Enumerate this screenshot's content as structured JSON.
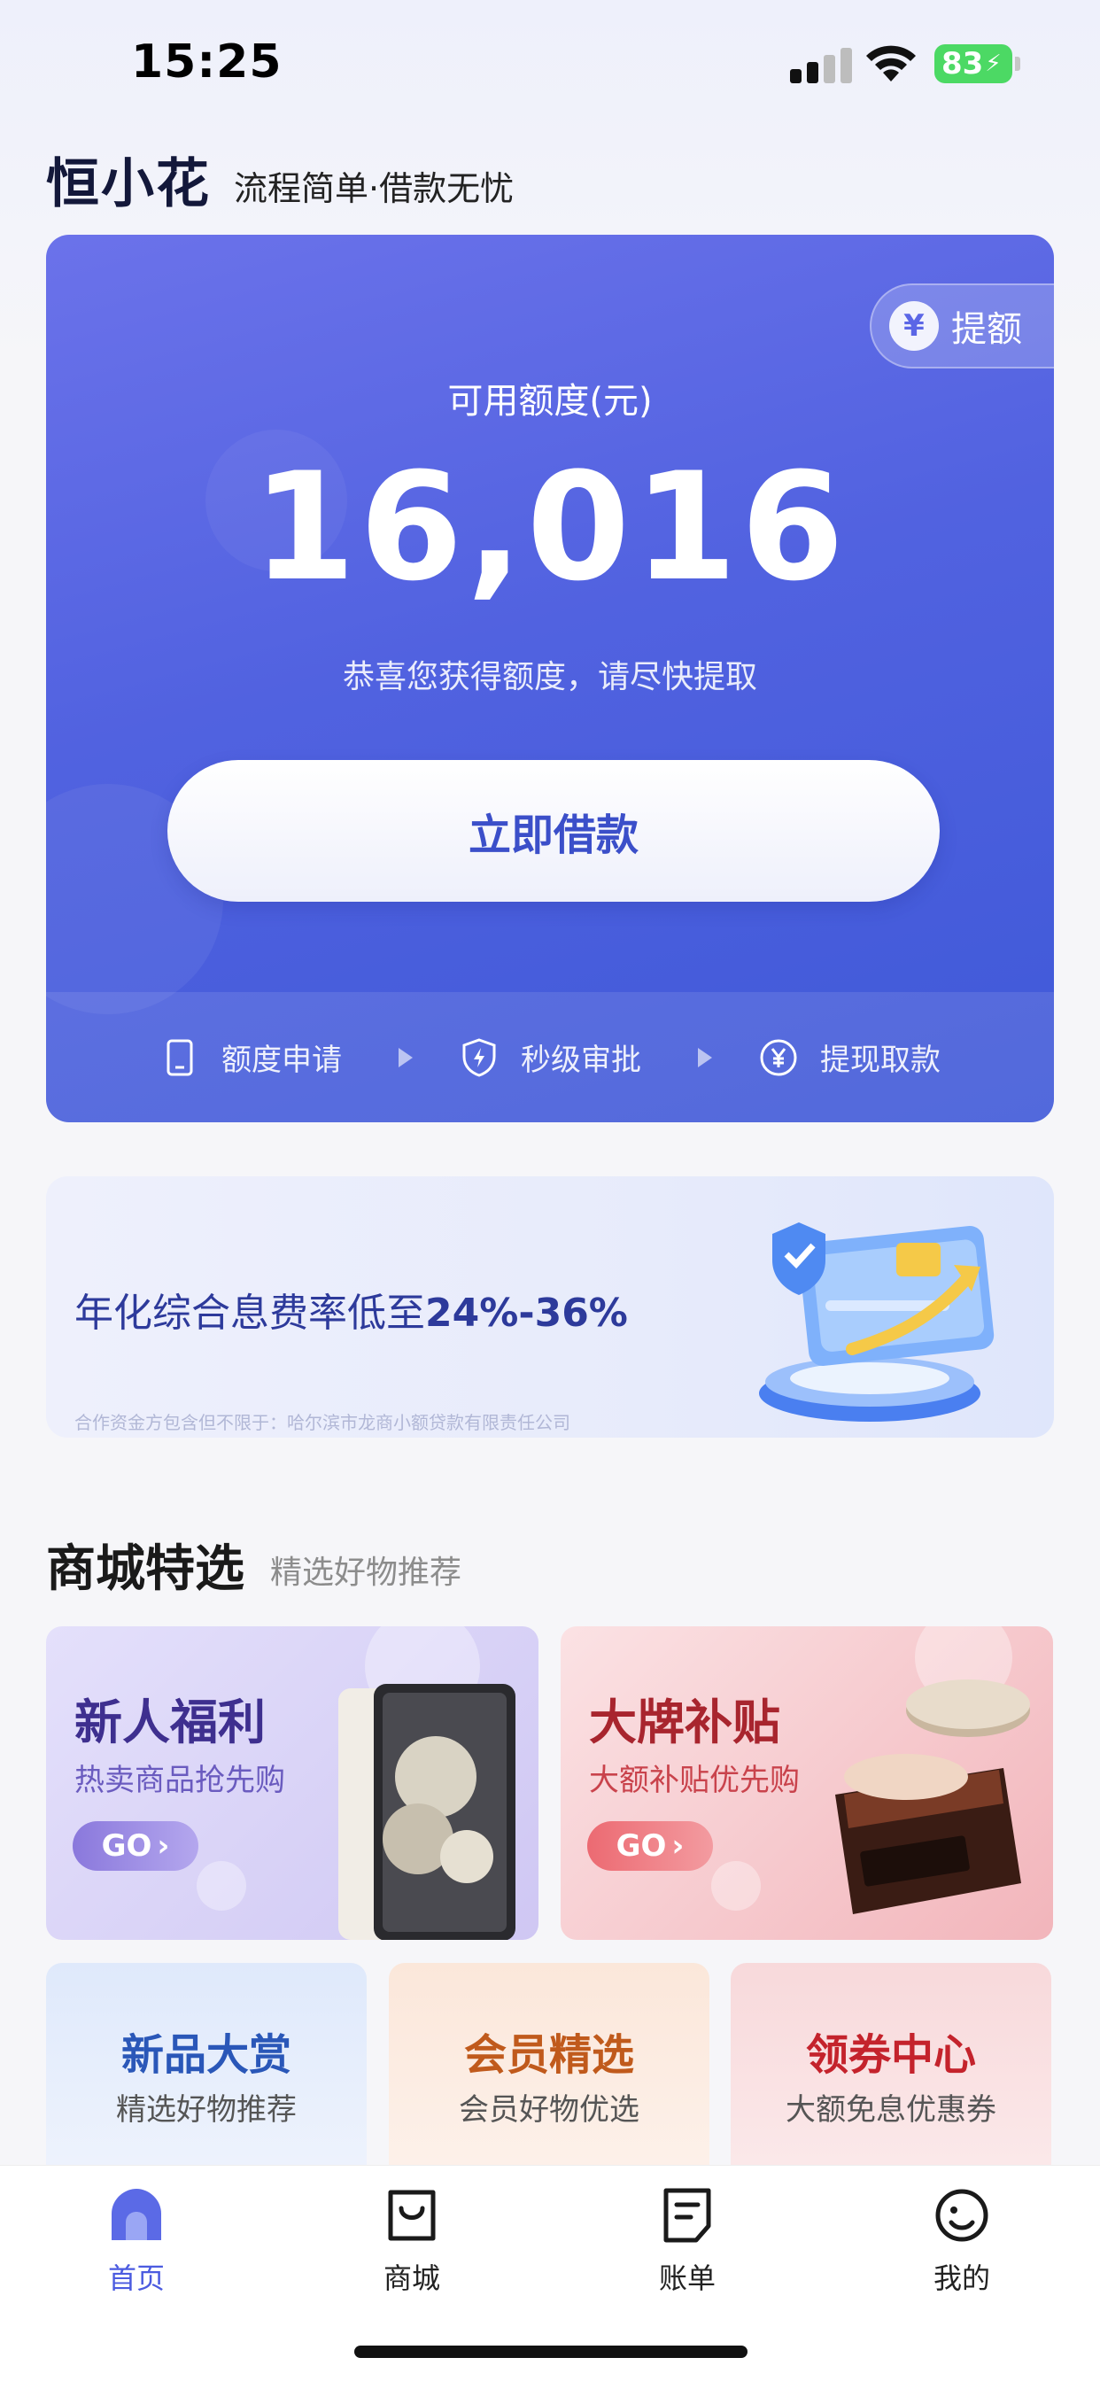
{
  "status_bar": {
    "time": "15:25",
    "battery": "83"
  },
  "brand": {
    "logo": "恒小花",
    "slogan": "流程简单·借款无忧"
  },
  "credit_card": {
    "raise_label": "提额",
    "yen_symbol": "¥",
    "available_label": "可用额度(元)",
    "available_amount": "16,016",
    "congrats_text": "恭喜您获得额度，请尽快提取",
    "borrow_button": "立即借款",
    "steps": [
      "额度申请",
      "秒级审批",
      "提现取款"
    ]
  },
  "promo": {
    "text_prefix": "年化综合息费率低至",
    "text_rate": "24%-36%",
    "note": "合作资金方包含但不限于：哈尔滨市龙商小额贷款有限责任公司"
  },
  "mall": {
    "title": "商城特选",
    "subtitle": "精选好物推荐",
    "big_tiles": [
      {
        "title": "新人福利",
        "subtitle": "热卖商品抢先购",
        "go": "GO"
      },
      {
        "title": "大牌补贴",
        "subtitle": "大额补贴优先购",
        "go": "GO"
      }
    ],
    "small_tiles": [
      {
        "title": "新品大赏",
        "subtitle": "精选好物推荐"
      },
      {
        "title": "会员精选",
        "subtitle": "会员好物优选"
      },
      {
        "title": "领券中心",
        "subtitle": "大额免息优惠券"
      }
    ]
  },
  "tabbar": {
    "items": [
      {
        "label": "首页",
        "icon": "home-icon"
      },
      {
        "label": "商城",
        "icon": "shopping-bag-icon"
      },
      {
        "label": "账单",
        "icon": "bill-icon"
      },
      {
        "label": "我的",
        "icon": "profile-icon"
      }
    ],
    "active_color": "#4b5be0"
  },
  "colors": {
    "card_primary": "#5162e0",
    "button_text": "#3b4fc9",
    "promo_text": "#2d3a9b"
  }
}
